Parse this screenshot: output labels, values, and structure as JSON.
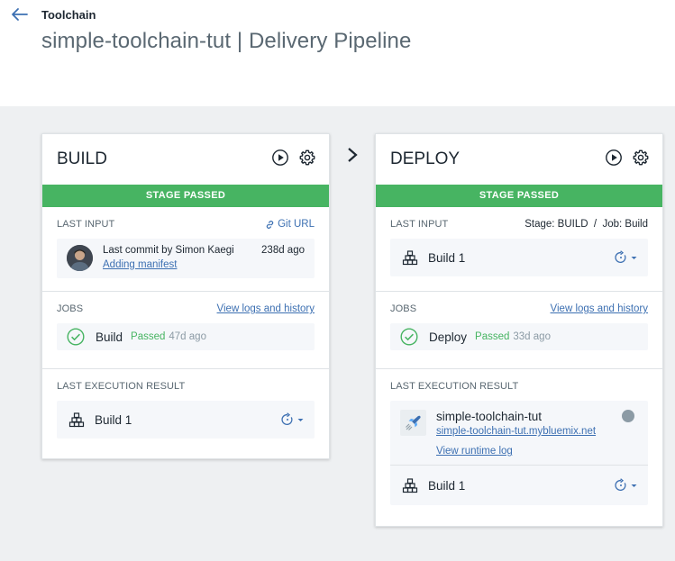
{
  "header": {
    "toolchain_label": "Toolchain",
    "title": "simple-toolchain-tut | Delivery Pipeline"
  },
  "colors": {
    "accent": "#3d70b2",
    "success": "#47b462",
    "canvas_bg": "#eef0f2"
  },
  "stages": {
    "build": {
      "title": "BUILD",
      "status": "STAGE PASSED",
      "last_input": {
        "label": "LAST INPUT",
        "link_label": "Git URL",
        "commit_by": "Last commit by Simon Kaegi",
        "commit_age": "238d ago",
        "commit_message": "Adding manifest"
      },
      "jobs": {
        "label": "JOBS",
        "link_label": "View logs and history",
        "items": [
          {
            "name": "Build",
            "status": "Passed",
            "age": "47d ago"
          }
        ]
      },
      "last_result": {
        "label": "LAST EXECUTION RESULT",
        "build_name": "Build 1"
      }
    },
    "deploy": {
      "title": "DEPLOY",
      "status": "STAGE PASSED",
      "last_input": {
        "label": "LAST INPUT",
        "meta": "Stage: BUILD  /  Job: Build",
        "build_name": "Build 1"
      },
      "jobs": {
        "label": "JOBS",
        "link_label": "View logs and history",
        "items": [
          {
            "name": "Deploy",
            "status": "Passed",
            "age": "33d ago"
          }
        ]
      },
      "last_result": {
        "label": "LAST EXECUTION RESULT",
        "app_name": "simple-toolchain-tut",
        "app_url": "simple-toolchain-tut.mybluemix.net",
        "runtime_log_label": "View runtime log",
        "build_name": "Build 1"
      }
    }
  }
}
